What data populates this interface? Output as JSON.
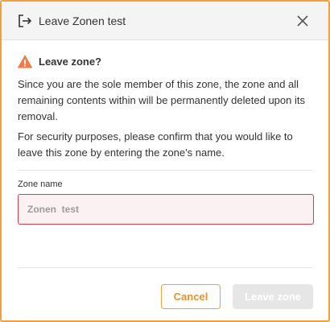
{
  "dialog": {
    "title": "Leave Zonen test",
    "close_icon": "close-icon",
    "header_icon": "logout-icon"
  },
  "warning": {
    "icon": "warning-icon",
    "title": "Leave zone?",
    "message": "Since you are the sole member of this zone, the zone and all remaining contents within will be permanently deleted upon its removal.",
    "instruction": "For security purposes, please confirm that you would like to leave this zone by entering the zone's name."
  },
  "form": {
    "zone_name_label": "Zone name",
    "zone_name_placeholder": "Zonen  test",
    "zone_name_value": ""
  },
  "buttons": {
    "cancel_label": "Cancel",
    "leave_label": "Leave zone"
  },
  "colors": {
    "accent": "#f0a03c",
    "error_border": "#c9404a",
    "error_background": "#fcf1f2",
    "warning_icon": "#f07c4a",
    "disabled_button": "#e6e6e6"
  }
}
